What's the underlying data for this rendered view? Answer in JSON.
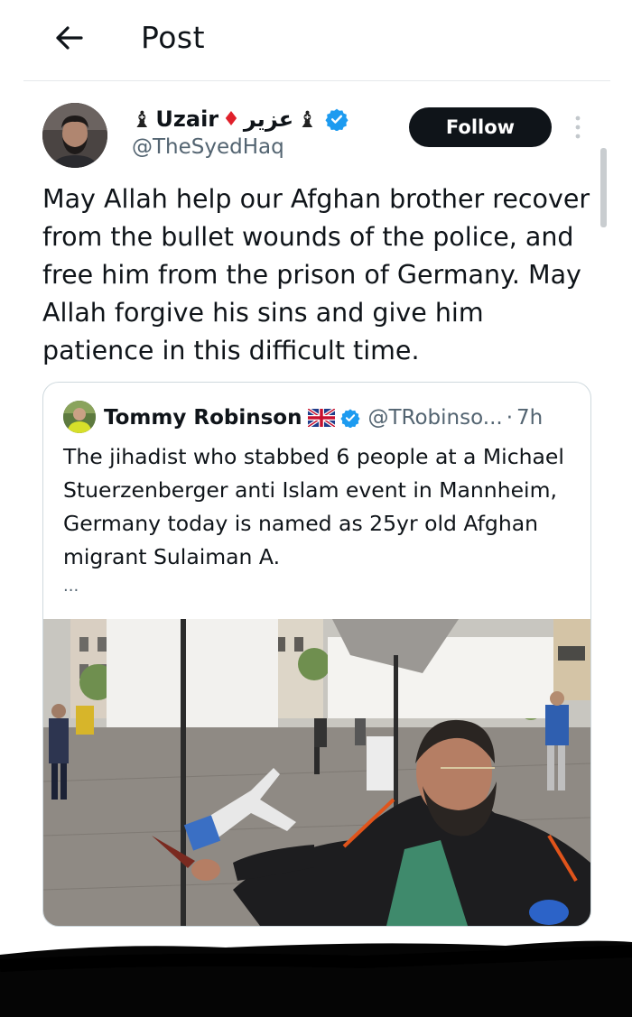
{
  "header": {
    "title": "Post"
  },
  "post": {
    "author": {
      "name": "Uzair",
      "arabic_name": "عزير",
      "name_decorations": [
        "chess-pawn-icon",
        "red-diamond-icon",
        "chess-pawn-icon"
      ],
      "handle": "@TheSyedHaq",
      "verified": true
    },
    "follow_label": "Follow",
    "text": "May Allah help our Afghan brother recover from the bullet wounds of the police, and free him from the prison of Germany. May Allah forgive his sins and give him patience in this difficult time.",
    "quote": {
      "author_name": "Tommy Robinson",
      "flag": "uk-flag-icon",
      "verified": true,
      "handle": "@TRobinso...",
      "separator": "·",
      "time": "7h",
      "text": "The jihadist who stabbed 6 people at a Michael Stuerzenberger anti Islam event in Mannheim, Germany today is named as 25yr old Afghan migrant Sulaiman A.",
      "more": "...",
      "media": "photo"
    }
  },
  "colors": {
    "text": "#0f1419",
    "secondary": "#536471",
    "verified_blue": "#1d9bf0",
    "follow_bg": "#0f1419",
    "border": "#cfd9de",
    "diamond": "#e0202a"
  }
}
